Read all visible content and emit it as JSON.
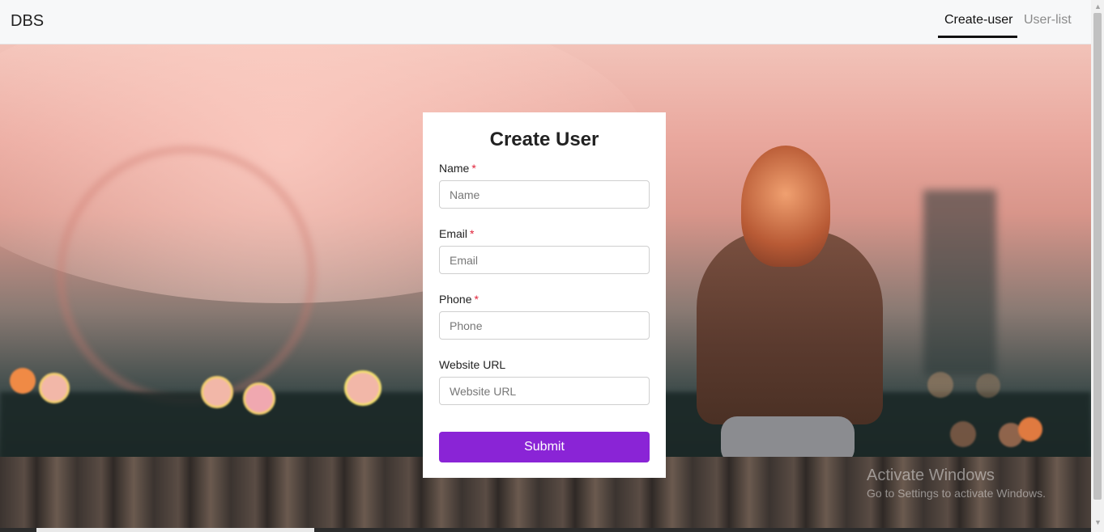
{
  "app": {
    "brand": "DBS"
  },
  "nav": {
    "items": [
      {
        "label": "Create-user",
        "active": true
      },
      {
        "label": "User-list",
        "active": false
      }
    ]
  },
  "form": {
    "title": "Create User",
    "fields": [
      {
        "label": "Name",
        "required_mark": "*",
        "placeholder": "Name",
        "value": ""
      },
      {
        "label": "Email",
        "required_mark": "*",
        "placeholder": "Email",
        "value": ""
      },
      {
        "label": "Phone",
        "required_mark": "*",
        "placeholder": "Phone",
        "value": ""
      },
      {
        "label": "Website URL",
        "placeholder": "Website URL",
        "value": ""
      }
    ],
    "submit_label": "Submit"
  },
  "watermark": {
    "line1": "Activate Windows",
    "line2": "Go to Settings to activate Windows."
  },
  "colors": {
    "accent": "#8a24d6",
    "required": "#e0233a",
    "navbar_bg": "#f7f8f9"
  },
  "icons": {
    "scroll_up": "scroll-up-arrow-icon",
    "scroll_down": "scroll-down-arrow-icon"
  }
}
